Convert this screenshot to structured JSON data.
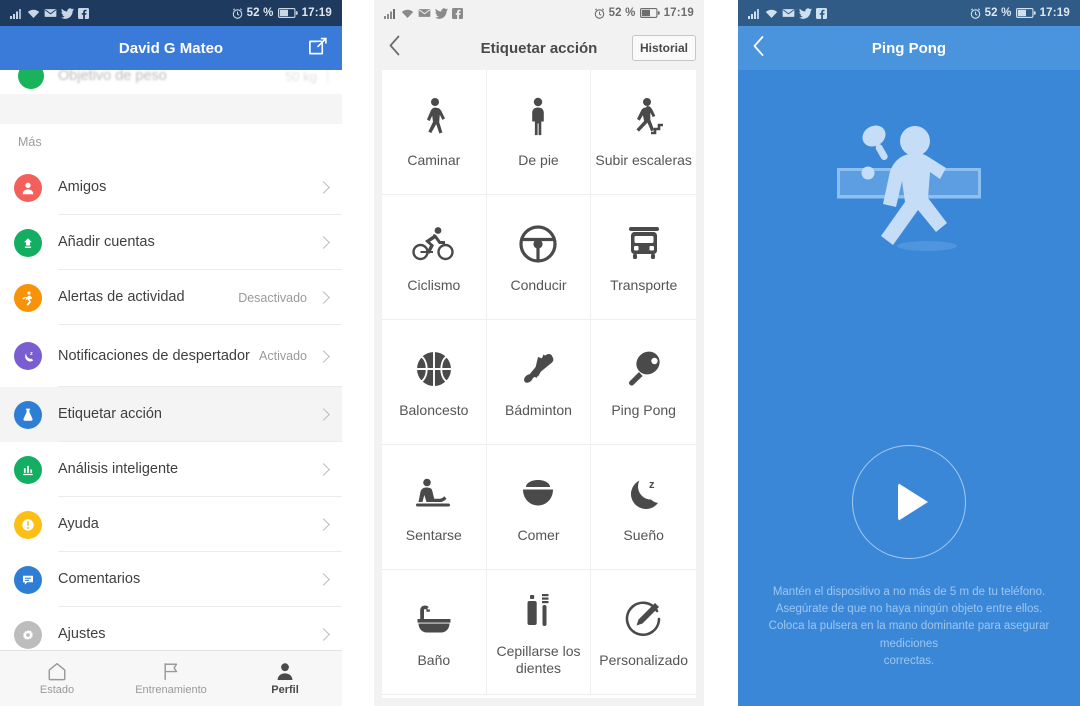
{
  "statusbar": {
    "icons": [
      "signal-icon",
      "wifi-icon",
      "mail-icon",
      "twitter-icon",
      "facebook-icon"
    ],
    "alarm_icon": "alarm-icon",
    "battery_percent": "52 %",
    "battery_icon": "battery-icon",
    "time": "17:19"
  },
  "panel1": {
    "header": {
      "title": "David G Mateo",
      "edit_icon": "edit-icon"
    },
    "clipped_row": {
      "label": "Objetivo de peso",
      "value": "50 kg",
      "icon": "weight-goal-icon"
    },
    "section_label": "Más",
    "items": [
      {
        "label": "Amigos",
        "value": "",
        "icon": "friends-icon",
        "color": "#f2605c"
      },
      {
        "label": "Añadir cuentas",
        "value": "",
        "icon": "add-account-icon",
        "color": "#13ae62"
      },
      {
        "label": "Alertas de actividad",
        "value": "Desactivado",
        "icon": "activity-alert-icon",
        "color": "#f79209"
      },
      {
        "label": "Notificaciones de despertador",
        "value": "Activado",
        "icon": "alarm-notify-icon",
        "color": "#7a5dd0"
      },
      {
        "label": "Etiquetar acción",
        "value": "",
        "icon": "tag-action-icon",
        "color": "#2e7fd4"
      },
      {
        "label": "Análisis inteligente",
        "value": "",
        "icon": "smart-analysis-icon",
        "color": "#13ae62"
      },
      {
        "label": "Ayuda",
        "value": "",
        "icon": "help-icon",
        "color": "#fbc013"
      },
      {
        "label": "Comentarios",
        "value": "",
        "icon": "feedback-icon",
        "color": "#2e7fd4"
      },
      {
        "label": "Ajustes",
        "value": "",
        "icon": "settings-gear-icon",
        "color": "#bdbdbd"
      }
    ],
    "bottom_nav": [
      {
        "label": "Estado",
        "icon": "home-icon",
        "active": false
      },
      {
        "label": "Entrenamiento",
        "icon": "flag-icon",
        "active": false
      },
      {
        "label": "Perfil",
        "icon": "profile-icon",
        "active": true
      }
    ]
  },
  "panel2": {
    "header": {
      "title": "Etiquetar acción",
      "back_icon": "back-chevron-icon",
      "history_label": "Historial"
    },
    "actions": [
      {
        "label": "Caminar",
        "icon": "walking-icon"
      },
      {
        "label": "De pie",
        "icon": "standing-icon"
      },
      {
        "label": "Subir escaleras",
        "icon": "stairs-icon"
      },
      {
        "label": "Ciclismo",
        "icon": "cycling-icon"
      },
      {
        "label": "Conducir",
        "icon": "steering-wheel-icon"
      },
      {
        "label": "Transporte",
        "icon": "bus-icon"
      },
      {
        "label": "Baloncesto",
        "icon": "basketball-icon"
      },
      {
        "label": "Bádminton",
        "icon": "shuttlecock-icon"
      },
      {
        "label": "Ping Pong",
        "icon": "ping-pong-paddle-icon"
      },
      {
        "label": "Sentarse",
        "icon": "sitting-icon"
      },
      {
        "label": "Comer",
        "icon": "bowl-icon"
      },
      {
        "label": "Sueño",
        "icon": "moon-sleep-icon"
      },
      {
        "label": "Baño",
        "icon": "bathtub-icon"
      },
      {
        "label": "Cepillarse los dientes",
        "icon": "toothbrush-icon"
      },
      {
        "label": "Personalizado",
        "icon": "custom-pencil-icon"
      }
    ]
  },
  "panel3": {
    "header": {
      "title": "Ping Pong",
      "back_icon": "back-chevron-icon"
    },
    "illustration_icon": "ping-pong-player-illustration",
    "play_button_icon": "play-icon",
    "hint_lines": [
      "Mantén el dispositivo a no más de 5 m de tu teléfono.",
      "Asegúrate de que no haya ningún objeto entre ellos.",
      "Coloca la pulsera en la mano dominante para asegurar mediciones",
      "correctas."
    ],
    "colors": {
      "background": "#3a87d8",
      "header": "#4a93dd",
      "hint_text": "#9ec6ee"
    }
  }
}
